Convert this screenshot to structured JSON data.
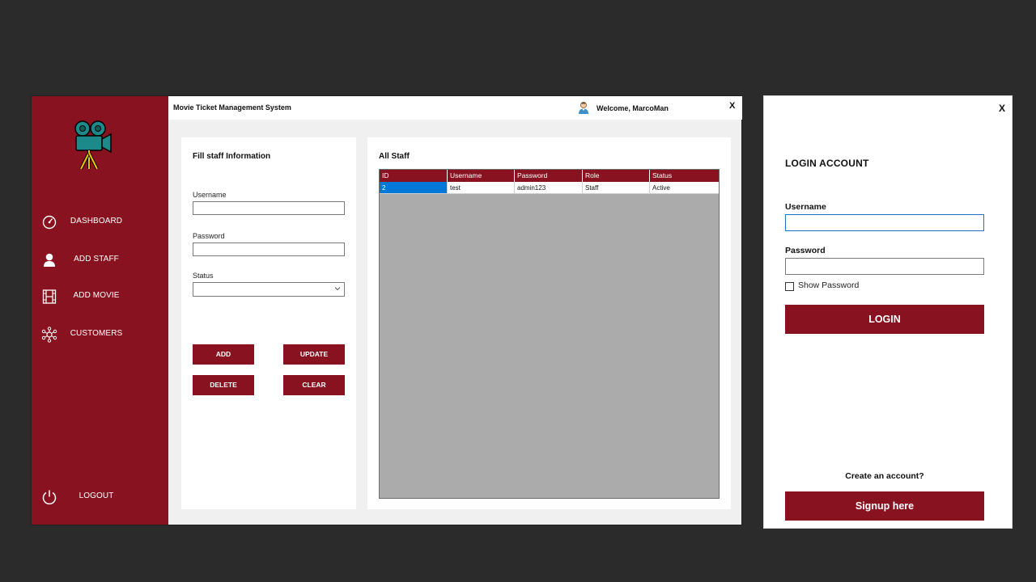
{
  "main_window": {
    "title": "Movie Ticket Management System",
    "welcome": "Welcome, MarcoMan",
    "close_label": "X",
    "sidebar": {
      "items": [
        {
          "label": "DASHBOARD",
          "icon": "gauge-icon"
        },
        {
          "label": "ADD STAFF",
          "icon": "user-icon"
        },
        {
          "label": "ADD MOVIE",
          "icon": "film-icon"
        },
        {
          "label": "CUSTOMERS",
          "icon": "network-icon"
        }
      ],
      "logout_label": "LOGOUT",
      "logo_icon": "movie-camera-icon"
    },
    "form": {
      "heading": "Fill staff Information",
      "username_label": "Username",
      "username_value": "",
      "password_label": "Password",
      "password_value": "",
      "status_label": "Status",
      "status_value": "",
      "buttons": {
        "add": "ADD",
        "update": "UPDATE",
        "delete": "DELETE",
        "clear": "CLEAR"
      }
    },
    "staff_table": {
      "heading": "All Staff",
      "columns": [
        "ID",
        "Username",
        "Password",
        "Role",
        "Status"
      ],
      "rows": [
        {
          "id": "2",
          "username": "test",
          "password": "admin123",
          "role": "Staff",
          "status": "Active"
        }
      ]
    }
  },
  "login_window": {
    "close_label": "X",
    "title": "LOGIN ACCOUNT",
    "username_label": "Username",
    "username_value": "",
    "password_label": "Password",
    "password_value": "",
    "show_password_label": "Show Password",
    "show_password_checked": false,
    "login_button": "LOGIN",
    "create_account_text": "Create an account?",
    "signup_button": "Signup here"
  },
  "colors": {
    "brand": "#891220",
    "background": "#2b2b2b",
    "selection": "#0078d7",
    "grid_background": "#ababab"
  }
}
